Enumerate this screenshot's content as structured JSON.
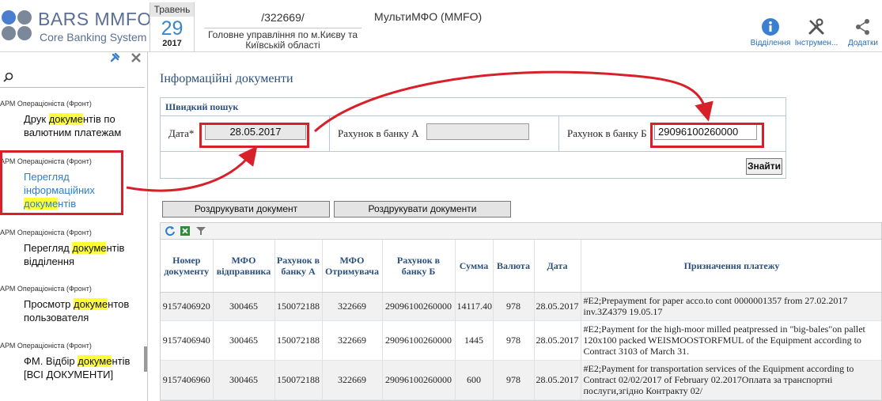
{
  "app": {
    "logo_title": "BARS MMFO",
    "logo_subtitle": "Core Banking System",
    "logo_colors": [
      "#5b6f94",
      "#4a90d9",
      "#7a8899"
    ],
    "date": {
      "month": "Травень",
      "day": "29",
      "year": "2017"
    },
    "mfo_code": "/322669/",
    "mfo_name": "Головне управління по м.Києву та Київській області",
    "title": "МультиМФО (MMFO)",
    "toolbar": [
      {
        "icon": "info-icon",
        "label": "Відділення"
      },
      {
        "icon": "tools-icon",
        "label": "Інструмен..."
      },
      {
        "icon": "share-icon",
        "label": "Додатки"
      }
    ]
  },
  "sidebar": {
    "items": [
      {
        "category": "АРМ Операціоніста (Фронт)",
        "label_parts": [
          "Друк ",
          "докуме",
          "нтів по валютним платежам"
        ],
        "active": false
      },
      {
        "category": "АРМ Операціоніста (Фронт)",
        "label_parts": [
          "Перегляд інформаційних ",
          "докуме",
          "нтів"
        ],
        "active": true
      },
      {
        "category": "АРМ Операціоніста (Фронт)",
        "label_parts": [
          "Перегляд ",
          "докуме",
          "нтів відділення"
        ],
        "active": false
      },
      {
        "category": "АРМ Операціоніста (Фронт)",
        "label_parts": [
          "Просмотр ",
          "докуме",
          "нтов пользователя"
        ],
        "active": false
      },
      {
        "category": "АРМ Операціоніста (Фронт)",
        "label_parts": [
          "ФМ. Відбір ",
          "докуме",
          "нтів [ВСІ ДОКУМЕНТИ]"
        ],
        "active": false
      }
    ]
  },
  "main": {
    "page_title": "Інформаційні документи",
    "quick_search": {
      "title": "Швидкий пошук",
      "date_label": "Дата*",
      "date_value": "28.05.2017",
      "account_a_label": "Рахунок в банку А",
      "account_a_value": "",
      "account_b_label": "Рахунок в банку Б",
      "account_b_value": "29096100260000",
      "find_button": "Знайти"
    },
    "print_document_button": "Роздрукувати документ",
    "print_documents_button": "Роздрукувати документи",
    "table": {
      "headers": [
        "Номер документу",
        "МФО відправника",
        "Рахунок в банку А",
        "МФО Отримувача",
        "Рахунок в банку Б",
        "Сумма",
        "Валюта",
        "Дата",
        "Призначення платежу"
      ],
      "rows": [
        [
          "9157406920",
          "300465",
          "150072188",
          "322669",
          "29096100260000",
          "14117.40",
          "978",
          "28.05.2017",
          "#E2;Prepayment for paper acco.to cont 0000001357 from 27.02.2017 inv.3Z4379 19.05.17"
        ],
        [
          "9157406940",
          "300465",
          "150072188",
          "322669",
          "29096100260000",
          "1445",
          "978",
          "28.05.2017",
          "#E2;Payment for the high-moor milled peatpressed in \"big-bales\"on pallet 120x100 packed WEISMOOSTORFMUL of the Equipment according to Contract 3103 of March 31."
        ],
        [
          "9157406960",
          "300465",
          "150072188",
          "322669",
          "29096100260000",
          "600",
          "978",
          "28.05.2017",
          "#E2;Payment for transportation services of the Equipment according to Contract 02/02/2017 of February 02.2017Оплата за транспортні послуги,згідно Контракту 02/"
        ]
      ]
    }
  },
  "annotation_color": "#d8202a"
}
